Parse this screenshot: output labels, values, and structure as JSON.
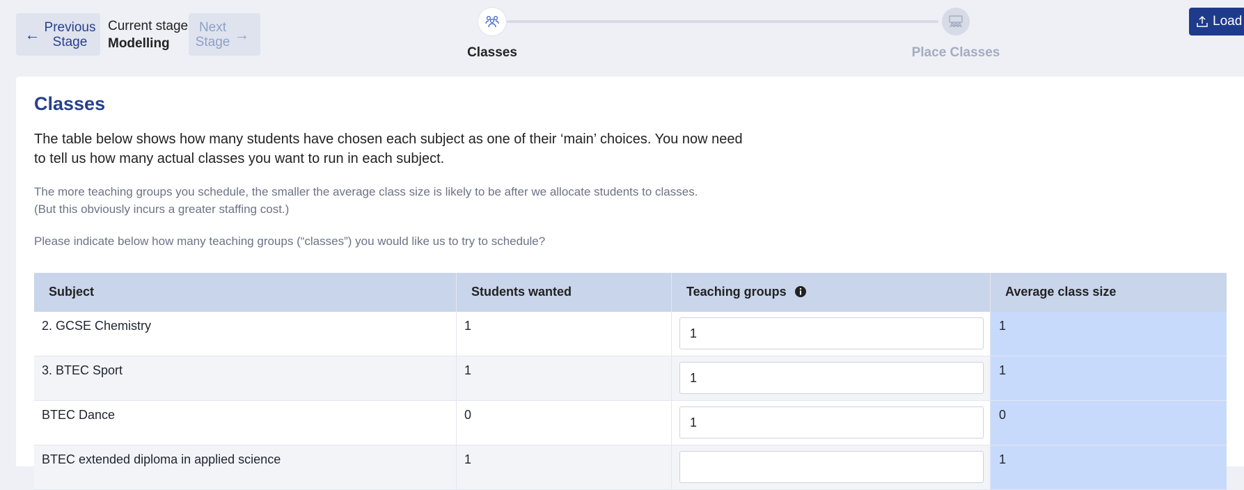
{
  "nav": {
    "prev_label_1": "Previous",
    "prev_label_2": "Stage",
    "current_stage_label": "Current stage",
    "current_stage_value": "Modelling",
    "next_label_1": "Next",
    "next_label_2": "Stage"
  },
  "stepper": {
    "steps": [
      {
        "label": "Classes",
        "icon": "people-group-icon",
        "active": true
      },
      {
        "label": "Place Classes",
        "icon": "classroom-icon",
        "active": false
      }
    ]
  },
  "load_button": {
    "label": "Load",
    "icon": "upload-icon"
  },
  "page": {
    "title": "Classes",
    "intro": "The table below shows how many students have chosen each subject as one of their ‘main’ choices. You now need to tell us how many actual classes you want to run in each subject.",
    "note_line_1": "The more teaching groups you schedule, the smaller the average class size is likely to be after we allocate students to classes.",
    "note_line_2": "(But this obviously incurs a greater staffing cost.)",
    "prompt": "Please indicate below how many teaching groups (“classes”) you would like us to try to schedule?"
  },
  "table": {
    "headers": [
      "Subject",
      "Students wanted",
      "Teaching groups",
      "Average class size"
    ],
    "rows": [
      {
        "subject": "2. GCSE Chemistry",
        "students": "1",
        "groups": "1",
        "avg": "1"
      },
      {
        "subject": "3. BTEC Sport",
        "students": "1",
        "groups": "1",
        "avg": "1"
      },
      {
        "subject": "BTEC Dance",
        "students": "0",
        "groups": "1",
        "avg": "0"
      },
      {
        "subject": "BTEC extended diploma in applied science",
        "students": "1",
        "groups": "",
        "avg": "1"
      }
    ]
  },
  "colors": {
    "accent": "#27408b",
    "load_button": "#1e3a8a",
    "table_header": "#c9d5ea",
    "avg_column": "#c8dafb"
  }
}
